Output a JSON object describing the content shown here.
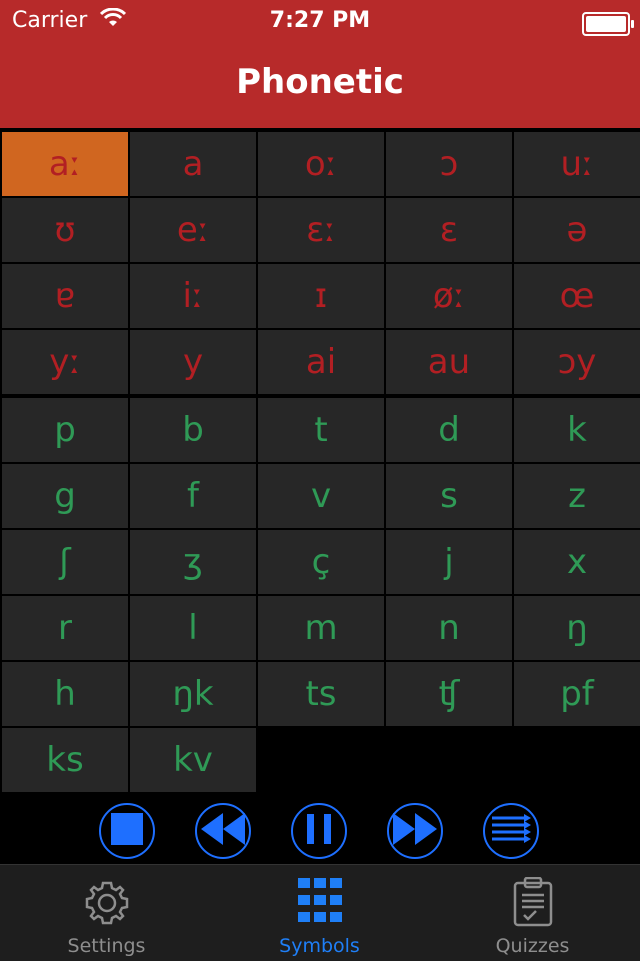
{
  "status": {
    "carrier": "Carrier",
    "time": "7:27 PM"
  },
  "header": {
    "title": "Phonetic"
  },
  "vowels": [
    "aː",
    "a",
    "oː",
    "ɔ",
    "uː",
    "ʊ",
    "eː",
    "ɛː",
    "ɛ",
    "ə",
    "ɐ",
    "iː",
    "ɪ",
    "øː",
    "œ",
    "yː",
    "y",
    "ai",
    "au",
    "ɔy"
  ],
  "consonants": [
    "p",
    "b",
    "t",
    "d",
    "k",
    "g",
    "f",
    "v",
    "s",
    "z",
    "ʃ",
    "ʒ",
    "ç",
    "j",
    "x",
    "r",
    "l",
    "m",
    "n",
    "ŋ",
    "h",
    "ŋk",
    "ts",
    "ʧ",
    "pf",
    "ks",
    "kv"
  ],
  "player": {
    "buttons": [
      "stop-icon",
      "rewind-icon",
      "pause-icon",
      "forward-icon",
      "playlist-icon"
    ]
  },
  "tabs": [
    {
      "label": "Settings",
      "icon": "gear-icon"
    },
    {
      "label": "Symbols",
      "icon": "grid-icon"
    },
    {
      "label": "Quizzes",
      "icon": "clipboard-icon"
    }
  ],
  "colors": {
    "header": "#b72a2a",
    "vowel": "#b21f23",
    "consonant": "#2f9a56",
    "active": "#d06620",
    "accent": "#1f7ff7"
  }
}
